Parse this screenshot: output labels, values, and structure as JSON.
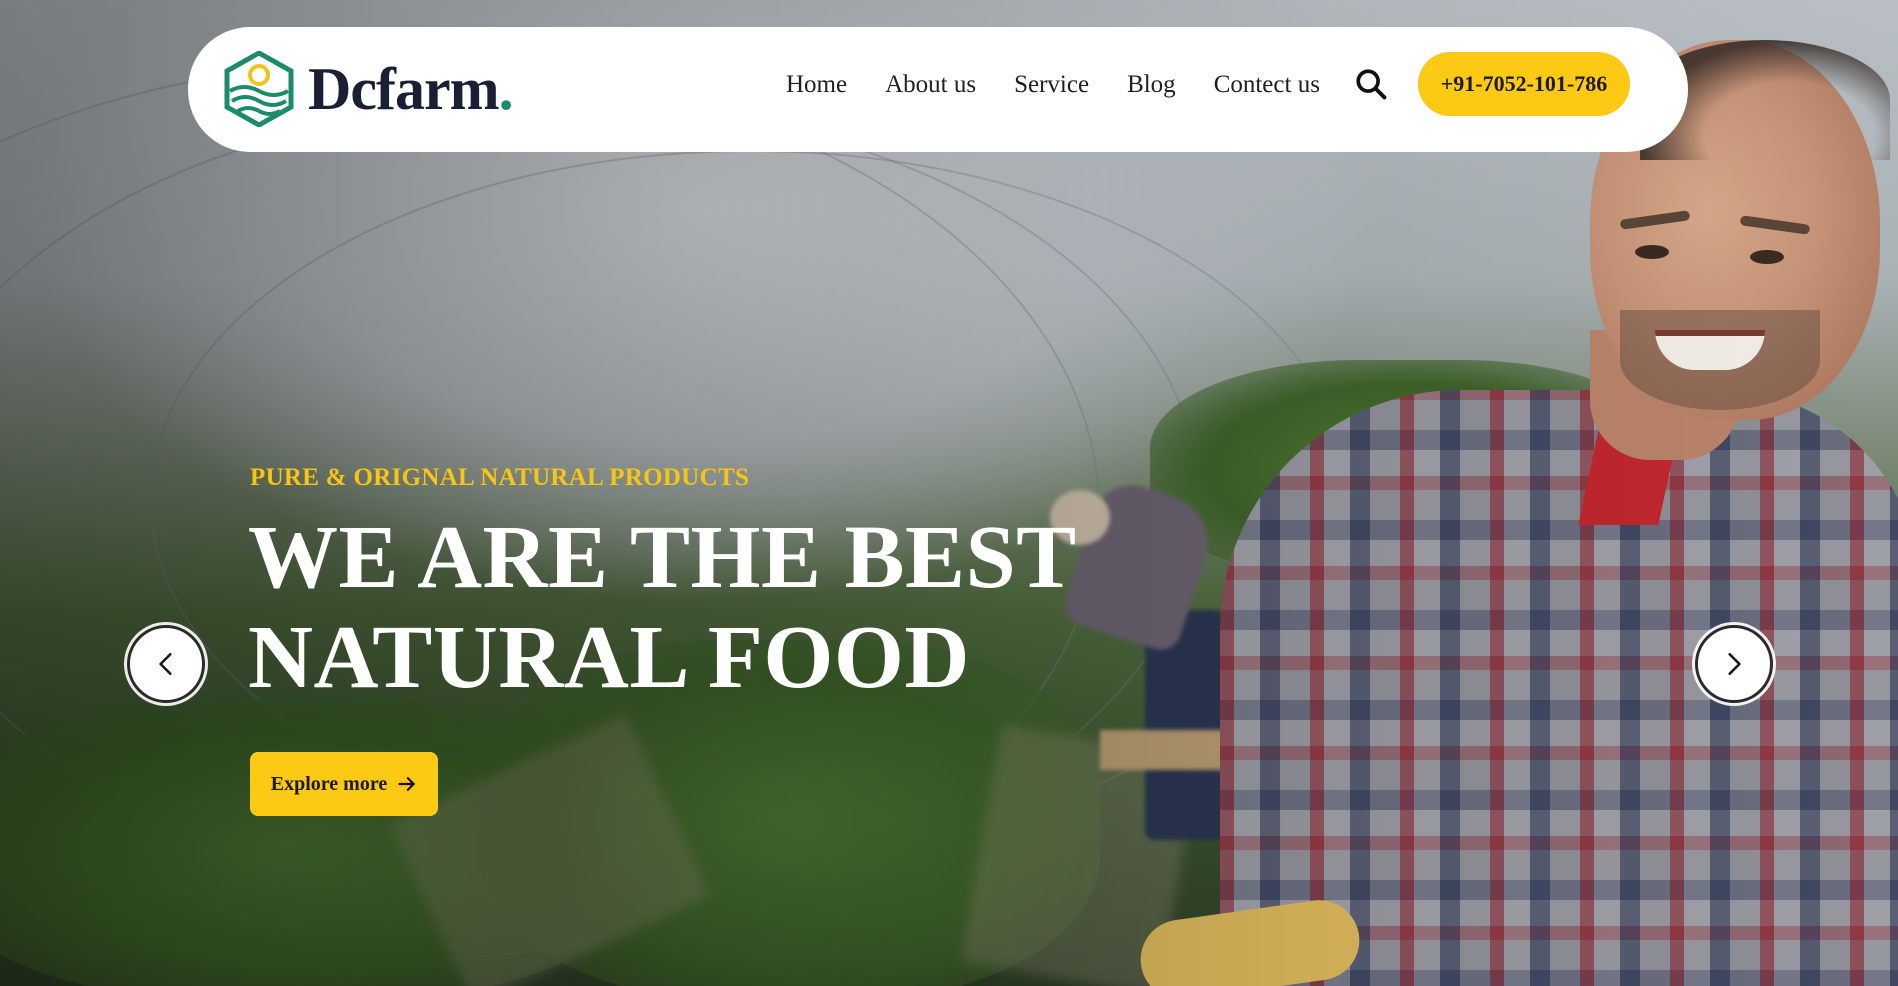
{
  "brand": {
    "name": "Dcfarm",
    "dot": ".",
    "accent": "#1c8b6a"
  },
  "nav": {
    "items": [
      {
        "label": "Home"
      },
      {
        "label": "About us"
      },
      {
        "label": "Service"
      },
      {
        "label": "Blog"
      },
      {
        "label": "Contect us"
      }
    ],
    "search_icon": "search-icon",
    "phone": "+91-7052-101-786"
  },
  "hero": {
    "eyebrow": "PURE & ORIGNAL NATURAL PRODUCTS",
    "headline_line1": "WE ARE THE BEST",
    "headline_line2": "NATURAL FOOD",
    "cta_label": "Explore more",
    "cta_icon": "arrow-right-icon",
    "prev_icon": "chevron-left-icon",
    "next_icon": "chevron-right-icon"
  },
  "colors": {
    "primary": "#fcc915",
    "dark": "#1b1f33",
    "white": "#ffffff"
  }
}
